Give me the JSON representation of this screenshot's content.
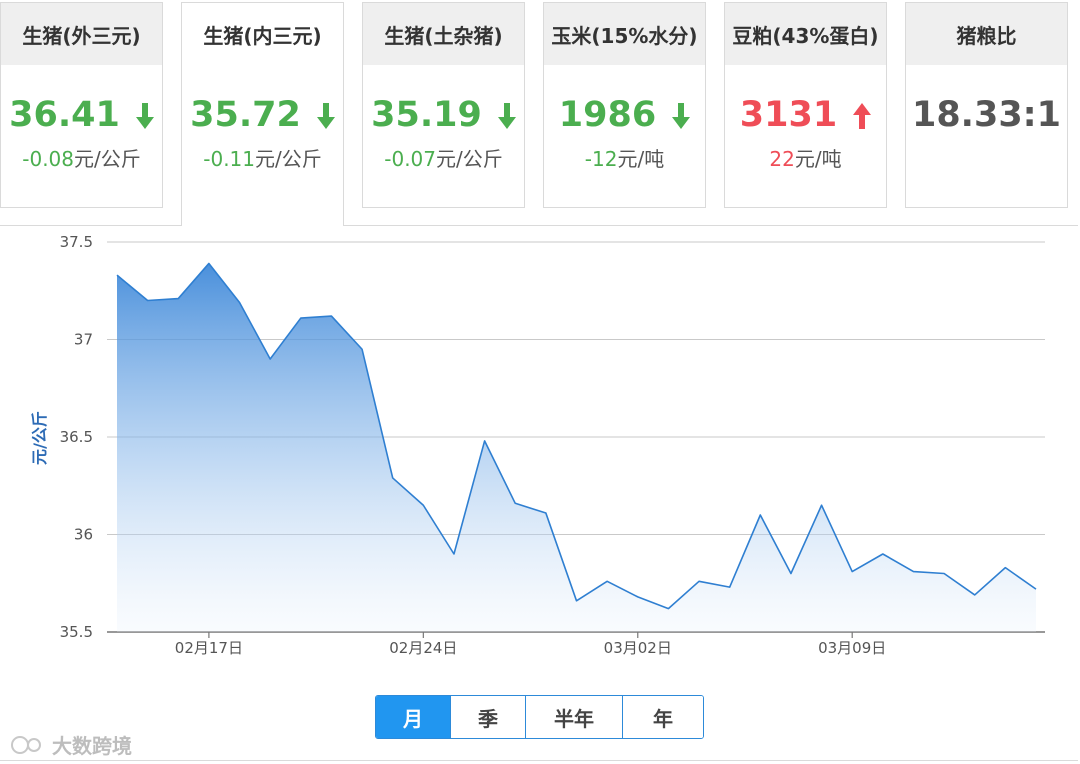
{
  "tabs": [
    {
      "name": "生猪(外三元)",
      "price": "36.41",
      "change_value": "-0.08",
      "change_unit": "元/公斤",
      "trend": "down"
    },
    {
      "name": "生猪(内三元)",
      "price": "35.72",
      "change_value": "-0.11",
      "change_unit": "元/公斤",
      "trend": "down"
    },
    {
      "name": "生猪(土杂猪)",
      "price": "35.19",
      "change_value": "-0.07",
      "change_unit": "元/公斤",
      "trend": "down"
    },
    {
      "name": "玉米(15%水分)",
      "price": "1986",
      "change_value": "-12",
      "change_unit": "元/吨",
      "trend": "down"
    },
    {
      "name": "豆粕(43%蛋白)",
      "price": "3131",
      "change_value": "22",
      "change_unit": "元/吨",
      "trend": "up"
    },
    {
      "name": "猪粮比",
      "price": "18.33:1",
      "change_value": "",
      "change_unit": "",
      "trend": "none"
    }
  ],
  "active_tab": 1,
  "colors": {
    "down": "#4bae4f",
    "up": "#ef4d57",
    "line": "#2f7fd1",
    "accent": "#2196f0"
  },
  "chart_data": {
    "type": "area",
    "ylabel": "元/公斤",
    "ylim": [
      35.5,
      37.5
    ],
    "yticks": [
      35.5,
      36,
      36.5,
      37,
      37.5
    ],
    "ytick_labels": [
      "35.5",
      "36",
      "36.5",
      "37",
      "37.5"
    ],
    "xticks": [
      {
        "index": 3,
        "label": "02月17日"
      },
      {
        "index": 10,
        "label": "02月24日"
      },
      {
        "index": 17,
        "label": "03月02日"
      },
      {
        "index": 24,
        "label": "03月09日"
      }
    ],
    "x": [
      "02月14日",
      "02月15日",
      "02月16日",
      "02月17日",
      "02月18日",
      "02月19日",
      "02月20日",
      "02月21日",
      "02月22日",
      "02月23日",
      "02月24日",
      "02月25日",
      "02月26日",
      "02月27日",
      "02月28日",
      "03月01日",
      "03月02日",
      "03月03日",
      "03月04日",
      "03月05日",
      "03月06日",
      "03月07日",
      "03月08日",
      "03月09日",
      "03月10日",
      "03月11日",
      "03月12日",
      "03月13日",
      "03月14日",
      "03月15日",
      "03月16日"
    ],
    "series": [
      {
        "values": [
          37.33,
          37.2,
          37.21,
          37.39,
          37.19,
          36.9,
          37.11,
          37.12,
          36.95,
          36.29,
          36.15,
          35.9,
          36.48,
          36.16,
          36.11,
          35.66,
          35.76,
          35.68,
          35.62,
          35.76,
          35.73,
          36.1,
          35.8,
          36.15,
          35.81,
          35.9,
          35.81,
          35.8,
          35.69,
          35.83,
          35.72
        ]
      }
    ],
    "grid": true
  },
  "ranges": {
    "items": [
      "月",
      "季",
      "半年",
      "年"
    ],
    "selected": 0
  },
  "watermark": "大数跨境"
}
